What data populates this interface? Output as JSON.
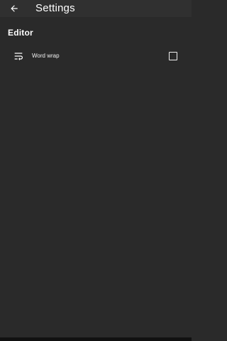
{
  "app_bar": {
    "title": "Settings",
    "back_icon": "arrow-back-icon"
  },
  "sections": [
    {
      "header": "Editor",
      "items": [
        {
          "label": "Word wrap",
          "icon": "wrap-text-icon",
          "checked": false
        }
      ]
    }
  ],
  "colors": {
    "background": "#2a2a2a",
    "app_bar": "#303030",
    "text": "#ffffff"
  }
}
